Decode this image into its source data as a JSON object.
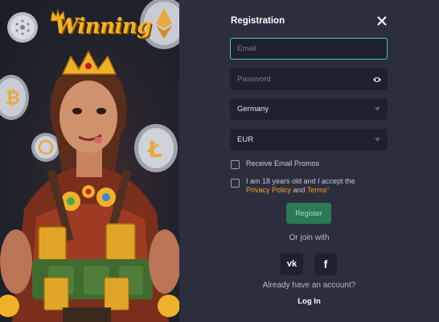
{
  "brand": {
    "logo_text": "Winning"
  },
  "form": {
    "title": "Registration",
    "email_placeholder": "Email",
    "password_placeholder": "Password",
    "country_value": "Germany",
    "currency_value": "EUR",
    "promo_label": "Receive Email Promos",
    "terms_prefix": "I am 18 years old and I accept the",
    "terms_privacy": "Privacy Policy",
    "terms_and": "and",
    "terms_terms": "Terms",
    "terms_star": "*",
    "register_label": "Register",
    "or_join": "Or join with",
    "social_vk": "vk",
    "social_fb": "f",
    "already_text": "Already have an account?",
    "login_label": "Log In"
  },
  "colors": {
    "accent_green": "#3fcf8e",
    "register_bg": "#2a7a58",
    "link_orange": "#f2a32a",
    "panel_bg": "#2d2e3d",
    "field_bg": "#1f2030"
  },
  "icons": [
    "close-icon",
    "eye-icon",
    "chevron-down-icon",
    "vk-icon",
    "facebook-icon",
    "crown-icon",
    "bitcoin-coin",
    "ethereum-coin",
    "litecoin-coin"
  ]
}
